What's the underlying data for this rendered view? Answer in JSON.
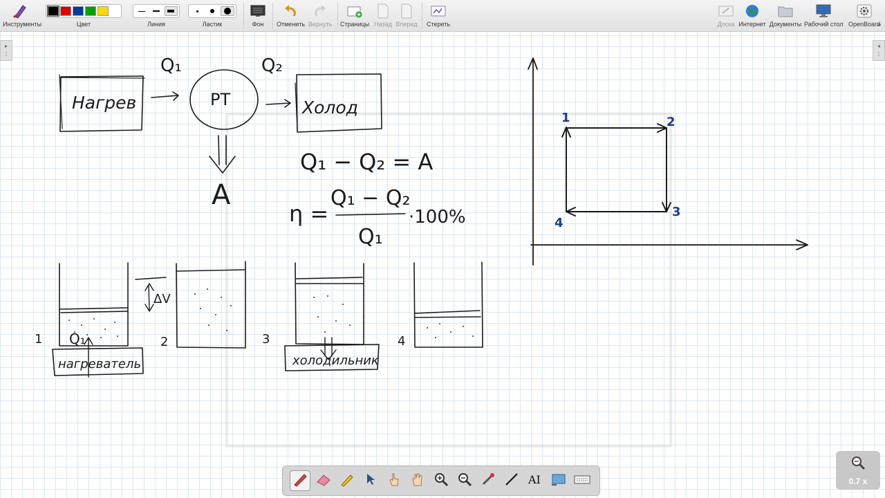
{
  "toolbar": {
    "left": [
      {
        "name": "tools",
        "label": "Инструменты"
      },
      {
        "name": "color",
        "label": "Цвет"
      },
      {
        "name": "line",
        "label": "Линия"
      },
      {
        "name": "eraser",
        "label": "Ластик"
      },
      {
        "name": "background",
        "label": "Фон"
      },
      {
        "name": "undo",
        "label": "Отменить"
      },
      {
        "name": "redo",
        "label": "Вернуть"
      },
      {
        "name": "pages",
        "label": "Страницы"
      },
      {
        "name": "back",
        "label": "Назад"
      },
      {
        "name": "forward",
        "label": "Вперед"
      },
      {
        "name": "erase",
        "label": "Стереть"
      }
    ],
    "right": [
      {
        "name": "board",
        "label": "Доска"
      },
      {
        "name": "internet",
        "label": "Интернет"
      },
      {
        "name": "documents",
        "label": "Документы"
      },
      {
        "name": "desktop",
        "label": "Рабочий стол"
      },
      {
        "name": "openboard",
        "label": "OpenBoard"
      }
    ],
    "colors": [
      "#000000",
      "#e00000",
      "#003c9c",
      "#00a000",
      "#ffd800"
    ]
  },
  "board": {
    "flow": {
      "heater": "Нагрев",
      "engine": "РТ",
      "cooler": "Холод",
      "q1": "Q₁",
      "q2": "Q₂",
      "work": "A"
    },
    "equations": {
      "balance": "Q₁ − Q₂ = A",
      "eta_symbol": "η =",
      "numerator": "Q₁ − Q₂",
      "denominator": "Q₁",
      "factor": "·100%"
    },
    "cylinders": {
      "labels": [
        "1",
        "2",
        "3",
        "4"
      ],
      "heater_label": "нагреватель",
      "cooler_label": "холодильник",
      "q_label": "Q₁",
      "dv_label": "ΔV"
    },
    "cycle": {
      "points": [
        "1",
        "2",
        "3",
        "4"
      ]
    }
  },
  "zoom": {
    "label": "0.7 x"
  },
  "ui_colors": {
    "toolbar": "#e8e8e8",
    "grid": "#dbe7f3",
    "ink": "#1b1b1b",
    "point_labels": "#1c3d8f"
  }
}
